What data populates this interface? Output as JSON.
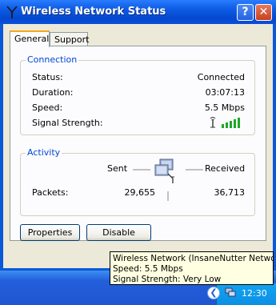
{
  "window": {
    "title": "Wireless Network Status",
    "help_glyph": "?",
    "close_glyph": "✕"
  },
  "tabs": [
    {
      "label": "General",
      "active": true
    },
    {
      "label": "Support",
      "active": false
    }
  ],
  "connection": {
    "group_title": "Connection",
    "status_label": "Status:",
    "status_value": "Connected",
    "duration_label": "Duration:",
    "duration_value": "03:07:13",
    "speed_label": "Speed:",
    "speed_value": "5.5 Mbps",
    "signal_label": "Signal Strength:",
    "signal_bars": 5,
    "signal_icon": "antenna-icon"
  },
  "activity": {
    "group_title": "Activity",
    "sent_label": "Sent",
    "received_label": "Received",
    "packets_label": "Packets:",
    "packets_sent": "29,655",
    "packets_received": "36,713",
    "activity_icon": "network-computers-icon"
  },
  "buttons": {
    "properties": "Properties",
    "disable": "Disable"
  },
  "tooltip": {
    "line1": "Wireless Network (InsaneNutter Network)",
    "line2": "Speed: 5.5 Mbps",
    "line3": "Signal Strength: Very Low"
  },
  "taskbar": {
    "clock": "12:30",
    "chevron_glyph": "❮",
    "tray_icon": "wireless-network-tray-icon"
  },
  "colors": {
    "titlebar": "#0b58d8",
    "group_title": "#0046d5",
    "signal_green": "#1fa828",
    "tooltip_bg": "#ffffe1"
  }
}
